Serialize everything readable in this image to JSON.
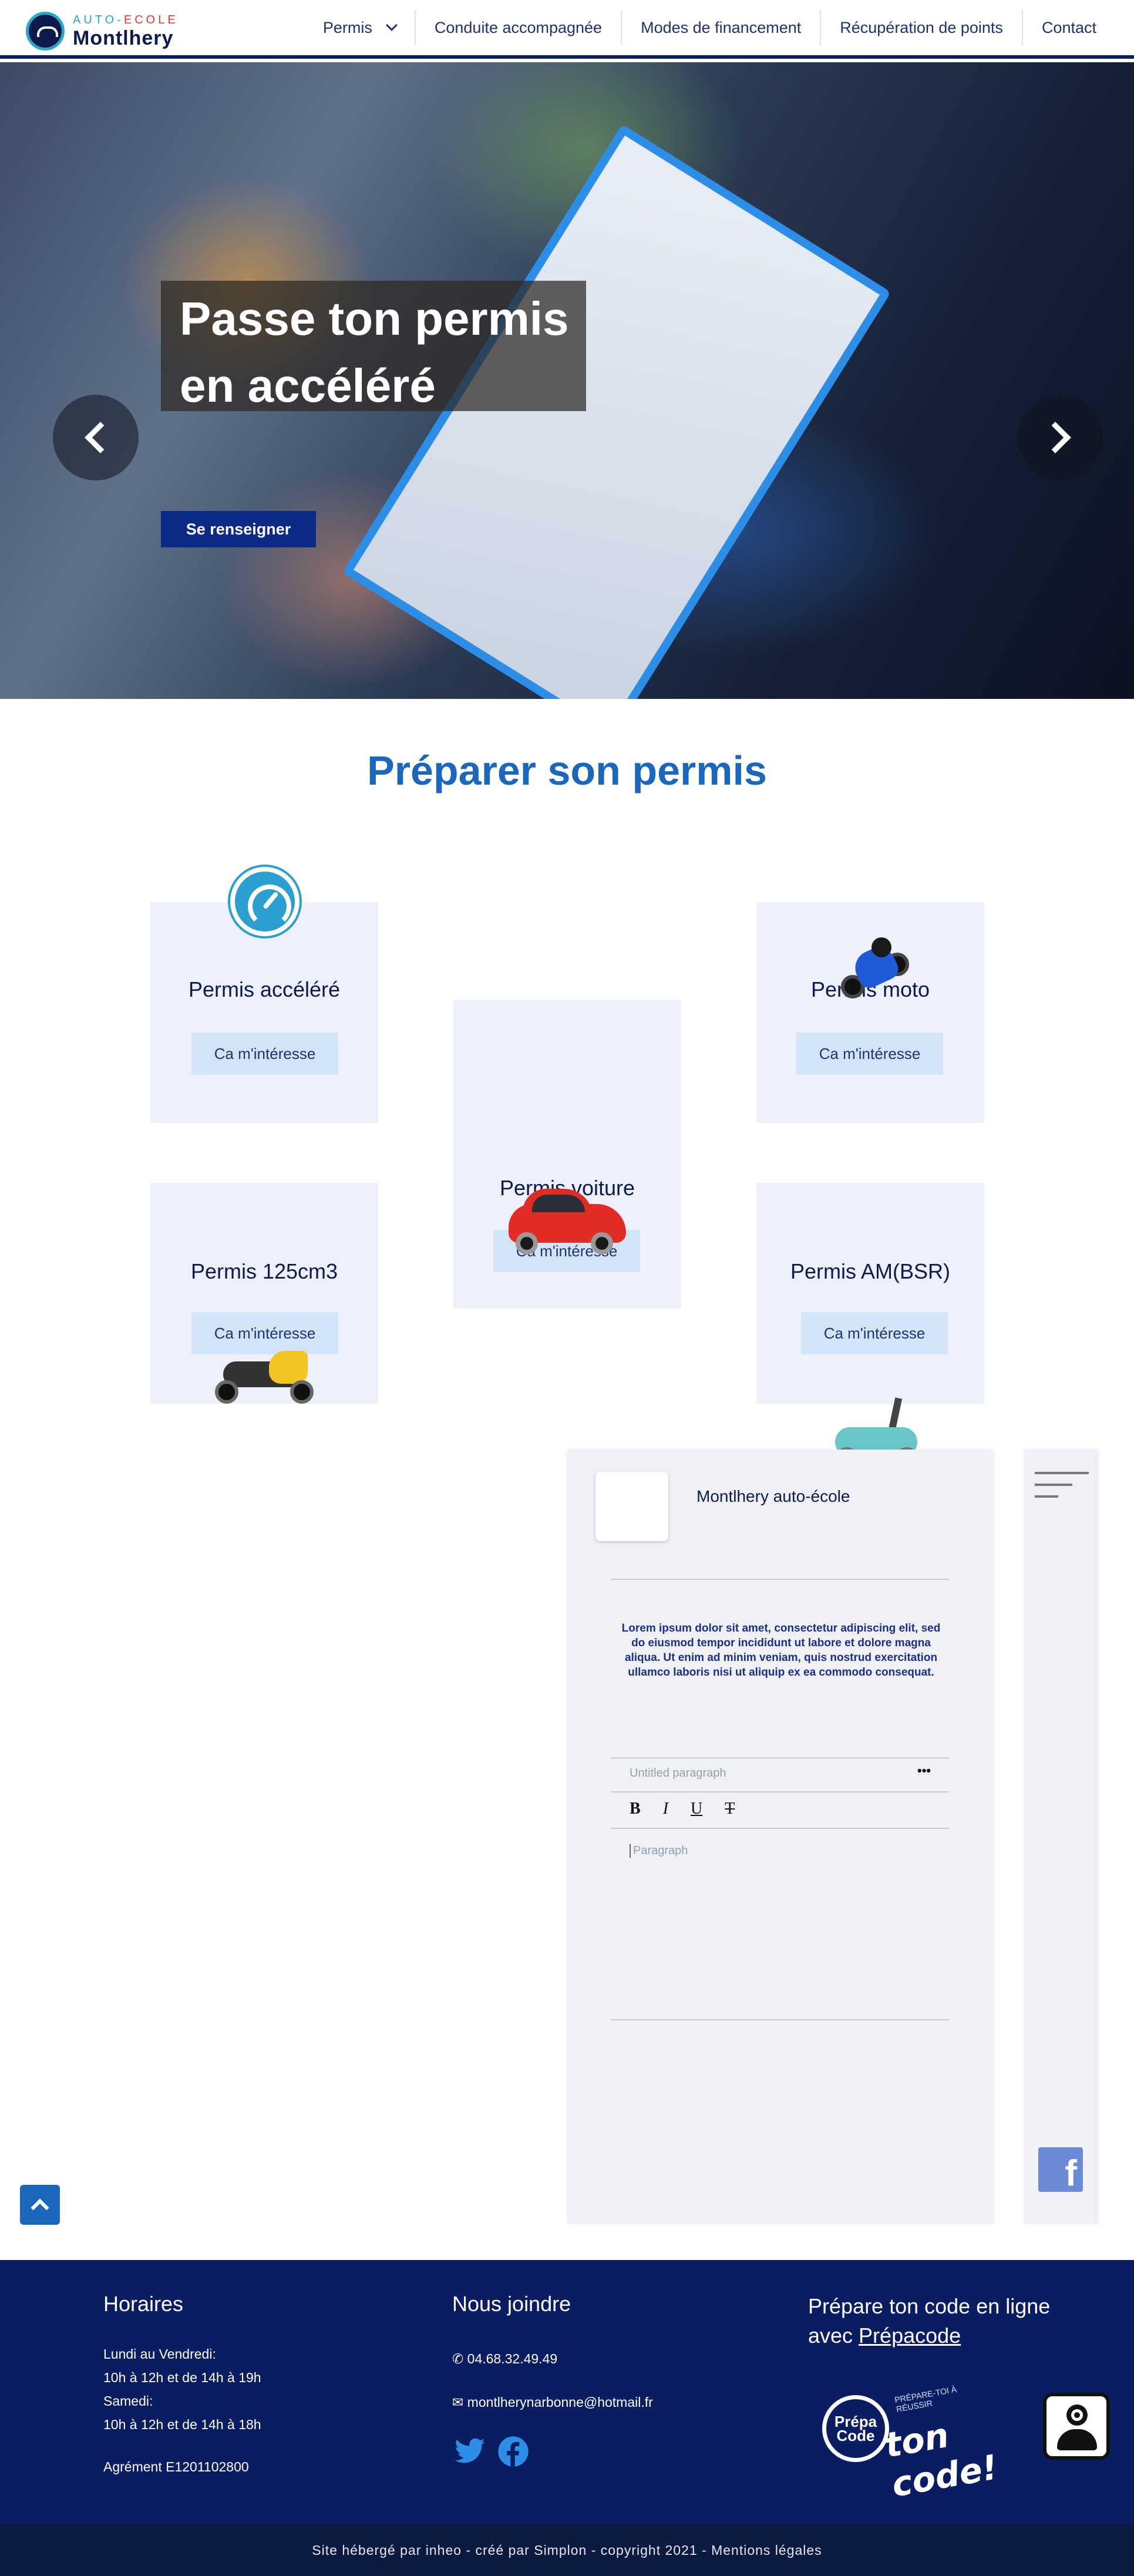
{
  "header": {
    "logo_top_a": "AUTO-",
    "logo_top_b": "ECOLE",
    "logo_bottom": "Montlhery",
    "nav": [
      {
        "label": "Permis"
      },
      {
        "label": "Conduite accompagnée"
      },
      {
        "label": "Modes de financement"
      },
      {
        "label": "Récupération de points"
      },
      {
        "label": "Contact"
      }
    ]
  },
  "hero": {
    "title_line1": "Passe ton permis",
    "title_line2": "en accéléré",
    "button": "Se renseigner"
  },
  "section": {
    "title": "Préparer son permis"
  },
  "cards": [
    {
      "title": "Permis accéléré",
      "button": "Ca m'intéresse",
      "icon": "speedometer-icon"
    },
    {
      "title": "Permis moto",
      "button": "Ca m'intéresse",
      "icon": "motorcycle-icon"
    },
    {
      "title": "Permis voiture",
      "button": "Ca m'intéresse",
      "icon": "car-icon"
    },
    {
      "title": "Permis 125cm3",
      "button": "Ca m'intéresse",
      "icon": "scooter-icon"
    },
    {
      "title": "Permis AM(BSR)",
      "button": "Ca m'intéresse",
      "icon": "vespa-icon"
    }
  ],
  "embed": {
    "page_name": "Montlhery auto-école",
    "lorem": "Lorem ipsum dolor sit amet, consectetur adipiscing elit, sed do eiusmod tempor incididunt ut labore et dolore magna aliqua. Ut enim ad minim veniam, quis nostrud exercitation ullamco laboris nisi ut aliquip ex ea commodo consequat.",
    "untitled": "Untitled paragraph",
    "dots": "•••",
    "tools": {
      "bold": "B",
      "italic": "I",
      "underline": "U",
      "strike": "T"
    },
    "paragraph_placeholder": "Paragraph",
    "fb_letter": "f"
  },
  "footer": {
    "horaires_title": "Horaires",
    "weekdays_label": "Lundi au Vendredi:",
    "weekdays_hours": "10h à 12h et de 14h à 19h",
    "saturday_label": "Samedi:",
    "saturday_hours": "10h à 12h et de 14h à 18h",
    "agrement": "Agrément E1201102800",
    "contact_title": "Nous joindre",
    "phone": "04.68.32.49.49",
    "email": "montlherynarbonne@hotmail.fr",
    "code_title_line1": "Prépare ton code en ligne",
    "code_title_line2_prefix": "avec ",
    "code_title_link": "Prépacode",
    "prepa_circle": "Prépa Code",
    "prepa_tag": "PRÉPARE-TOI À RÉUSSIR",
    "prepa_code": "ton code!"
  },
  "bottom_bar": {
    "text": "Site hébergé par inheo - créé par Simplon - copyright 2021 - Mentions légales"
  },
  "colors": {
    "brand_navy": "#0a1d63",
    "accent_blue": "#1b67bd",
    "card_bg": "#eef0fb",
    "card_button_bg": "#d3e4f7"
  }
}
